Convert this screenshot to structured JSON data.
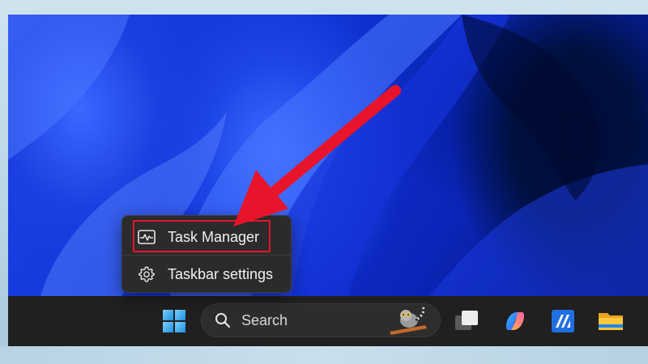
{
  "context_menu": {
    "items": [
      {
        "label": "Task Manager",
        "icon": "task-manager-icon"
      },
      {
        "label": "Taskbar settings",
        "icon": "gear-icon"
      }
    ]
  },
  "taskbar": {
    "search": {
      "label": "Search",
      "icon": "search-icon",
      "highlight": "lemur-illustration"
    },
    "apps": [
      "windows-start-icon",
      "task-view-icon",
      "copilot-icon",
      "microsoft-store-icon",
      "file-explorer-icon"
    ]
  },
  "annotation": {
    "color": "#e8142b",
    "highlighted_item": "Task Manager"
  },
  "colors": {
    "taskbar": "#202020",
    "menu": "#2b2b2b",
    "wallpaper_accent": "#1e44e8"
  }
}
